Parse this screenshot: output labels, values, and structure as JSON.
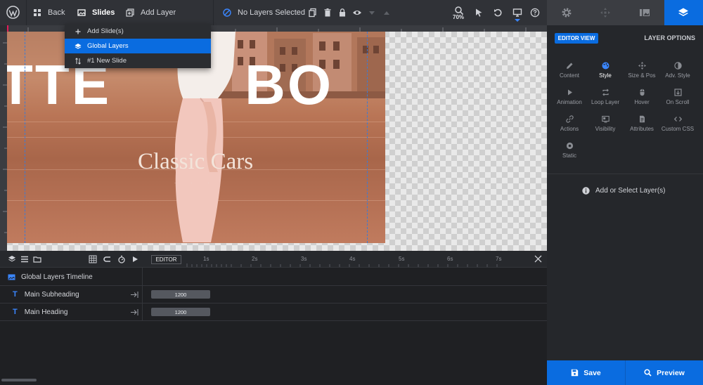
{
  "topbar": {
    "back_label": "Back",
    "slides_label": "Slides",
    "add_layer_label": "Add Layer",
    "selection_status": "No Layers Selected",
    "zoom": "70%"
  },
  "dropdown": {
    "items": [
      {
        "label": "Add Slide(s)",
        "icon": "plus-icon"
      },
      {
        "label": "Global Layers",
        "icon": "layers-icon"
      },
      {
        "label": "#1 New Slide",
        "icon": "sort-icon"
      }
    ]
  },
  "slide": {
    "big_text_left": "TTE",
    "big_text_right": "BO",
    "subheading": "Classic Cars",
    "tiny_text": "· · ·"
  },
  "timeline": {
    "editor_label": "EDITOR",
    "ticks": [
      "1s",
      "2s",
      "3s",
      "4s",
      "5s",
      "6s",
      "7s"
    ],
    "group_label": "Global Layers Timeline",
    "layers": [
      {
        "label": "Main Subheading",
        "duration": "1200"
      },
      {
        "label": "Main Heading",
        "duration": "1200"
      }
    ]
  },
  "panel": {
    "editor_view": "EDITOR VIEW",
    "layer_options": "LAYER OPTIONS",
    "options": [
      {
        "label": "Content",
        "icon": "pencil-icon"
      },
      {
        "label": "Style",
        "icon": "palette-icon"
      },
      {
        "label": "Size & Pos",
        "icon": "move-icon"
      },
      {
        "label": "Adv. Style",
        "icon": "contrast-icon"
      },
      {
        "label": "Animation",
        "icon": "play-icon"
      },
      {
        "label": "Loop Layer",
        "icon": "loop-icon"
      },
      {
        "label": "Hover",
        "icon": "mouse-icon"
      },
      {
        "label": "On Scroll",
        "icon": "scroll-icon"
      },
      {
        "label": "Actions",
        "icon": "link-icon"
      },
      {
        "label": "Visibility",
        "icon": "visibility-icon"
      },
      {
        "label": "Attributes",
        "icon": "document-icon"
      },
      {
        "label": "Custom CSS",
        "icon": "code-icon"
      },
      {
        "label": "Static",
        "icon": "static-icon"
      }
    ],
    "info": "Add or Select Layer(s)",
    "save_label": "Save",
    "preview_label": "Preview"
  },
  "colors": {
    "accent": "#0a6ce0",
    "toolbar": "#303237",
    "panel": "#25272b"
  }
}
